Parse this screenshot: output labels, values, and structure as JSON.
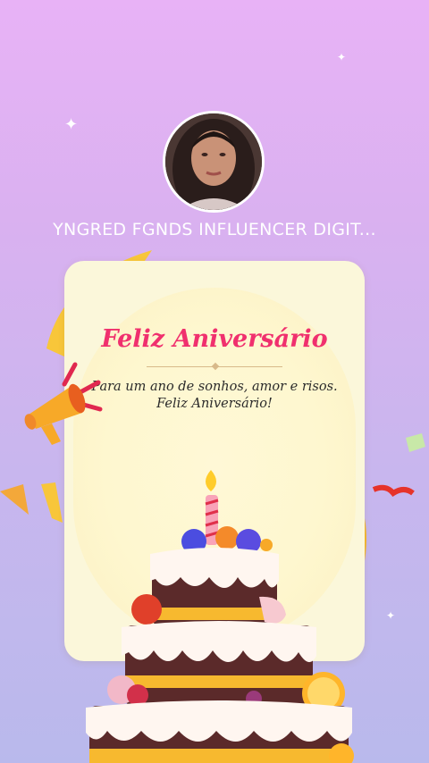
{
  "profile": {
    "username": "YNGRED FGNDS INFLUENCER DIGIT..."
  },
  "card": {
    "title": "Feliz Aniversário",
    "message_line1": "Para um ano de sonhos, amor e risos.",
    "message_line2": "Feliz Aniversário!"
  },
  "colors": {
    "title": "#f0306e",
    "background_top": "#e8b2f6",
    "background_bottom": "#b9b9ec",
    "card": "#fbf7da"
  },
  "icons": [
    "megaphone-icon",
    "birthday-cake-icon",
    "candle-icon",
    "sparkle-icon",
    "confetti-icon"
  ]
}
